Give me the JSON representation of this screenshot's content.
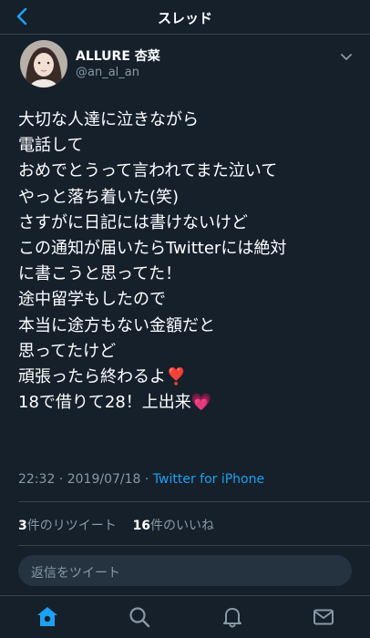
{
  "header": {
    "title": "スレッド"
  },
  "tweet": {
    "author_name": "ALLURE 杏菜",
    "author_handle": "@an_al_an",
    "lines": [
      "大切な人達に泣きながら",
      "電話して",
      "おめでとうって言われてまた泣いて",
      "やっと落ち着いた(笑)",
      "さすがに日記には書けないけど",
      "この通知が届いたらTwitterには絶対",
      "に書こうと思ってた！",
      "途中留学もしたので",
      "本当に途方もない金額だと",
      "思ってたけど",
      "頑張ったら終わるよ❣️",
      "18で借りて28！上出来💗"
    ],
    "time": "22:32",
    "date": "2019/07/18",
    "separator": " · ",
    "source": "Twitter for iPhone",
    "retweets_count": "3",
    "retweets_label": "件のリツイート",
    "likes_count": "16",
    "likes_label": "件のいいね"
  },
  "reply": {
    "placeholder": "返信をツイート"
  },
  "tabs": [
    {
      "name": "home",
      "icon": "home-icon",
      "active": true
    },
    {
      "name": "search",
      "icon": "search-icon",
      "active": false
    },
    {
      "name": "notifications",
      "icon": "bell-icon",
      "active": false
    },
    {
      "name": "messages",
      "icon": "mail-icon",
      "active": false
    }
  ],
  "colors": {
    "accent": "#1da1f2",
    "background": "#15202b",
    "secondary_text": "#8899a6"
  }
}
